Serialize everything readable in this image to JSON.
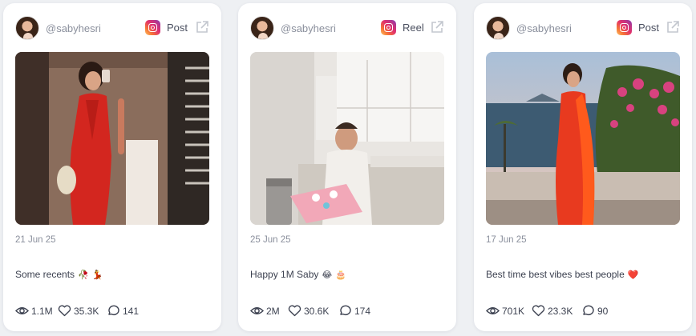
{
  "posts": [
    {
      "handle": "@sabyhesri",
      "type": "Post",
      "platform_icon": "instagram-icon",
      "date": "21 Jun 25",
      "caption": "Some recents",
      "caption_emojis": [
        "🥀",
        "💃"
      ],
      "views": "1.1M",
      "likes": "35.3K",
      "comments": "141"
    },
    {
      "handle": "@sabyhesri",
      "type": "Reel",
      "platform_icon": "instagram-icon",
      "date": "25 Jun 25",
      "caption": "Happy 1M Saby",
      "caption_emojis": [
        "😂",
        "🎂"
      ],
      "views": "2M",
      "likes": "30.6K",
      "comments": "174"
    },
    {
      "handle": "@sabyhesri",
      "type": "Post",
      "platform_icon": "instagram-icon",
      "date": "17 Jun 25",
      "caption": "Best time best vibes best people",
      "caption_emojis": [
        "❤️"
      ],
      "views": "701K",
      "likes": "23.3K",
      "comments": "90"
    }
  ],
  "colors": {
    "background": "#eef0f3",
    "card": "#ffffff",
    "muted_text": "#8a8f9c",
    "body_text": "#3c4150"
  }
}
